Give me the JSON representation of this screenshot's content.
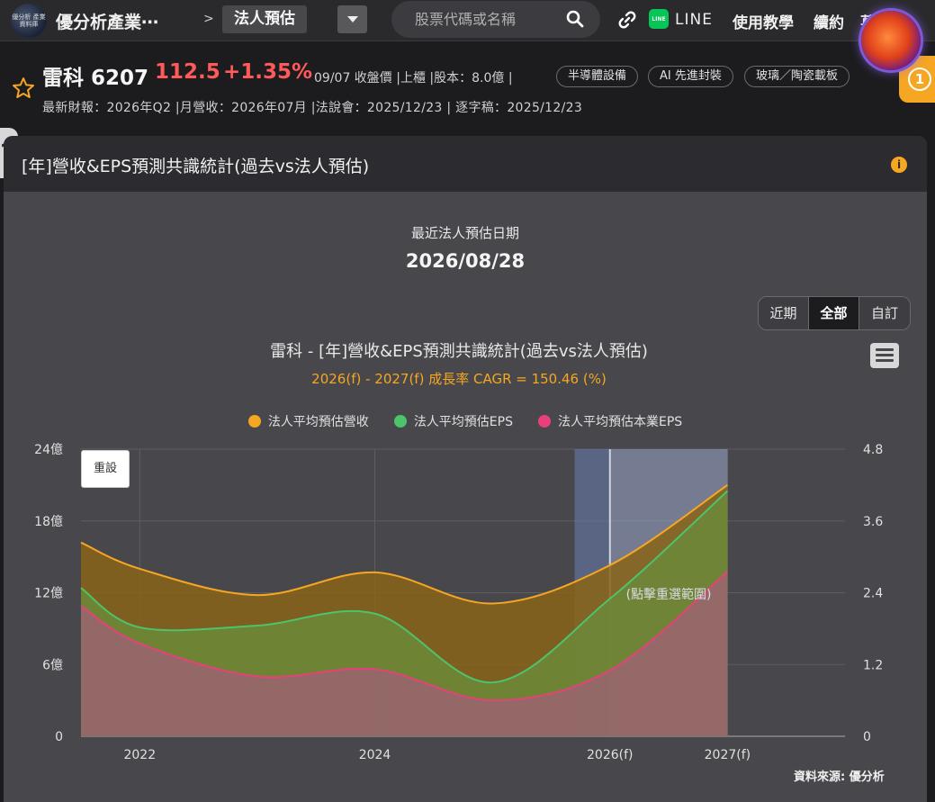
{
  "nav": {
    "logo_text": "優分析 產業資料庫",
    "site_title": "優分析產業⋯",
    "breadcrumb_sep": ">",
    "current_page": "法人預估",
    "search_placeholder": "股票代碼或名稱",
    "line_label": "LINE",
    "links": [
      "使用教學",
      "續約",
      "萇"
    ]
  },
  "notification": {
    "count": "1"
  },
  "stock": {
    "name": "雷科 6207",
    "price": "112.5",
    "change": "+1.35%",
    "meta": "09/07 收盤價 |上櫃 |股本：8.0億 |",
    "tags": [
      "半導體設備",
      "AI 先進封裝",
      "玻璃／陶瓷載板"
    ],
    "sub_info": "最新財報：2026年Q2 |月營收：2026年07月 |法說會：2025/12/23 | 逐字稿：2025/12/23"
  },
  "card": {
    "title": "[年]營收&EPS預測共識統計(過去vs法人預估)",
    "info": "i",
    "est_label": "最近法人預估日期",
    "est_date": "2026/08/28",
    "ranges": [
      "近期",
      "全部",
      "自訂"
    ],
    "active_range": "全部",
    "reset_label": "重設",
    "source": "資料來源: 優分析"
  },
  "colors": {
    "revenue": "#f5a623",
    "eps": "#4cc46a",
    "core_eps": "#e8407a",
    "accent": "#f5a623"
  },
  "chart_data": {
    "type": "area",
    "title": "雷科 - [年]營收&EPS預測共識統計(過去vs法人預估)",
    "subtitle": "2026(f) - 2027(f) 成長率 CAGR = 150.46 (%)",
    "x": [
      2021.5,
      2022,
      2023,
      2024,
      2025,
      2026,
      2027
    ],
    "x_ticks": [
      "2022",
      "2024",
      "2026(f)",
      "2027(f)"
    ],
    "y_left": {
      "ticks": [
        "0",
        "6億",
        "12億",
        "18億",
        "24億"
      ],
      "ylim": [
        0,
        24
      ]
    },
    "y_right": {
      "ticks": [
        "0",
        "1.2",
        "2.4",
        "3.6",
        "4.8"
      ],
      "ylim": [
        0,
        4.8
      ]
    },
    "series": [
      {
        "name": "法人平均預估營收",
        "axis": "left",
        "values": [
          16.2,
          14.0,
          11.8,
          13.7,
          11.1,
          14.3,
          21.0
        ]
      },
      {
        "name": "法人平均預估EPS",
        "axis": "right",
        "values": [
          2.48,
          1.82,
          1.85,
          2.05,
          0.9,
          2.3,
          4.1
        ]
      },
      {
        "name": "法人平均預估本業EPS",
        "axis": "right",
        "values": [
          2.18,
          1.55,
          1.0,
          1.12,
          0.6,
          1.1,
          2.75
        ]
      }
    ],
    "selection_hint": "(點擊重選範圍)",
    "legend": "top"
  }
}
